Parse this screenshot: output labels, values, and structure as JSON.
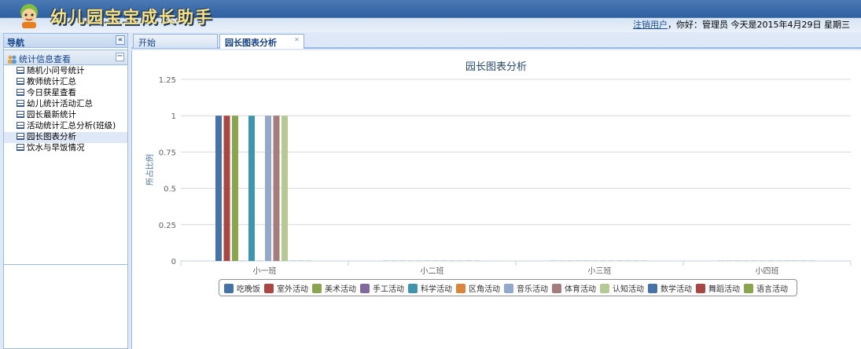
{
  "header": {
    "app_title": "幼儿园宝宝成长助手",
    "logout_link": "注销用户",
    "greeting": "，你好：管理员 今天是2015年4月29日 星期三"
  },
  "nav": {
    "title": "导航",
    "collapse_icon": "double-chevron-left-icon",
    "group_title": "统计信息查看",
    "items": [
      {
        "label": "随机小问号统计"
      },
      {
        "label": "教师统计汇总"
      },
      {
        "label": "今日获星查看"
      },
      {
        "label": "幼儿统计活动汇总"
      },
      {
        "label": "园长最新统计"
      },
      {
        "label": "活动统计汇总分析(班级)"
      },
      {
        "label": "园长图表分析",
        "selected": true
      },
      {
        "label": "饮水与早饭情况"
      }
    ]
  },
  "tabs": [
    {
      "label": "开始",
      "active": false
    },
    {
      "label": "园长图表分析",
      "active": true,
      "closable": true
    }
  ],
  "chart_data": {
    "type": "bar",
    "title": "园长图表分析",
    "xlabel": "",
    "ylabel": "所占比例",
    "ylim": [
      0,
      1.25
    ],
    "yticks": [
      "0",
      "0.25",
      "0.5",
      "0.75",
      "1",
      "1.25"
    ],
    "grid": true,
    "legend_placement": "bottom",
    "categories": [
      "小一班",
      "小二班",
      "小三班",
      "小四班"
    ],
    "series": [
      {
        "name": "吃晚饭",
        "color": "#4572a7",
        "values": [
          1,
          0,
          0,
          0
        ]
      },
      {
        "name": "室外活动",
        "color": "#aa4643",
        "values": [
          1,
          0,
          0,
          0
        ]
      },
      {
        "name": "美术活动",
        "color": "#89a54e",
        "values": [
          1,
          0,
          0,
          0
        ]
      },
      {
        "name": "手工活动",
        "color": "#80699b",
        "values": [
          0,
          0,
          0,
          0
        ]
      },
      {
        "name": "科学活动",
        "color": "#3d96ae",
        "values": [
          1,
          0,
          0,
          0
        ]
      },
      {
        "name": "区角活动",
        "color": "#db843d",
        "values": [
          0,
          0,
          0,
          0
        ]
      },
      {
        "name": "音乐活动",
        "color": "#92a8cd",
        "values": [
          1,
          0,
          0,
          0
        ]
      },
      {
        "name": "体育活动",
        "color": "#a47d7c",
        "values": [
          1,
          0,
          0,
          0
        ]
      },
      {
        "name": "认知活动",
        "color": "#b5ca92",
        "values": [
          1,
          0,
          0,
          0
        ]
      },
      {
        "name": "数学活动",
        "color": "#4572a7",
        "values": [
          0,
          0,
          0,
          0
        ]
      },
      {
        "name": "舞蹈活动",
        "color": "#aa4643",
        "values": [
          0,
          0,
          0,
          0
        ]
      },
      {
        "name": "语言活动",
        "color": "#89a54e",
        "values": [
          0,
          0,
          0,
          0
        ]
      }
    ]
  }
}
